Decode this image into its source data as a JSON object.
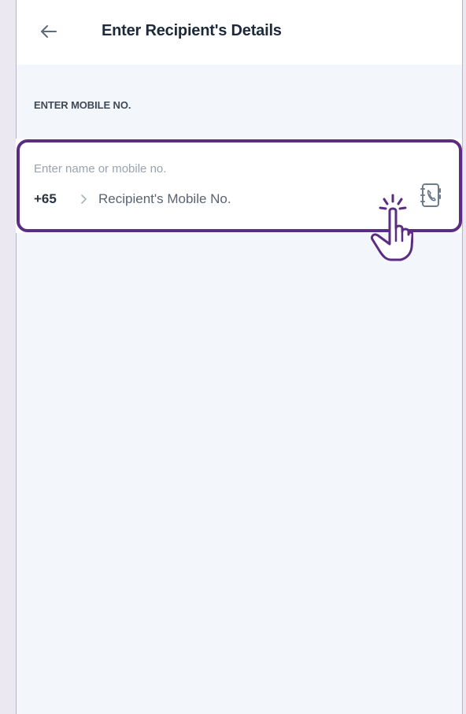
{
  "header": {
    "title": "Enter Recipient's Details",
    "back_icon": "arrow-left-icon"
  },
  "section": {
    "label": "ENTER MOBILE NO."
  },
  "recipient_field": {
    "hint": "Enter name or mobile no.",
    "country_code": "+65",
    "mobile_placeholder": "Recipient's Mobile No.",
    "mobile_value": "",
    "contacts_icon": "contact-book-icon"
  },
  "overlay": {
    "tap_indicator_icon": "hand-pointer-tap-icon",
    "highlight_color": "#5b2d82"
  },
  "colors": {
    "background": "#f3f6fa",
    "header_bg": "#ffffff",
    "title_text": "#1d2a3a",
    "accent": "#5b2d82"
  }
}
